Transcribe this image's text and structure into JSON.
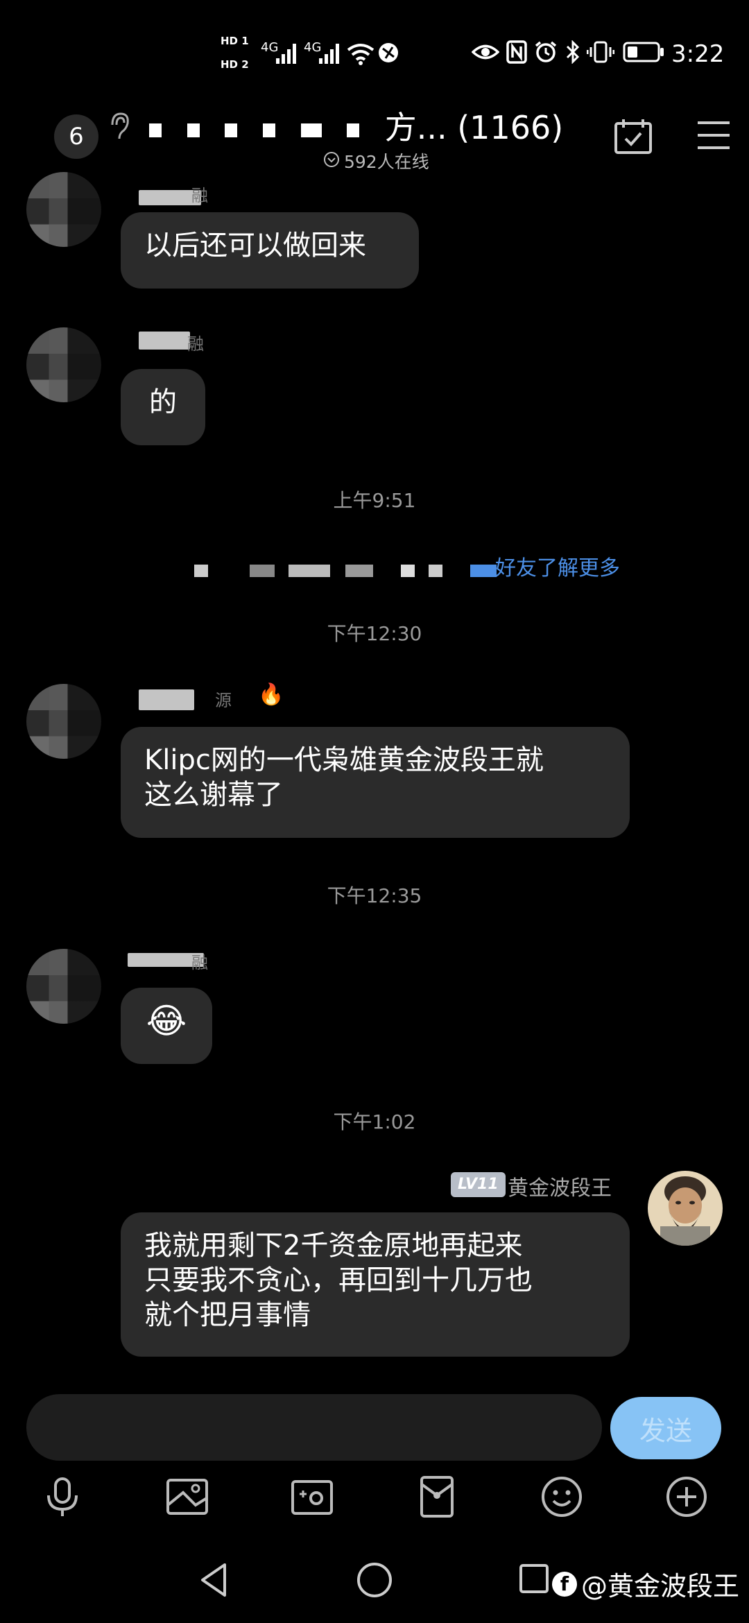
{
  "status_bar": {
    "hd1": "HD 1",
    "hd2": "HD 2",
    "net1": "4G",
    "net2": "4G",
    "time": "3:22"
  },
  "header": {
    "unread_count": "6",
    "group_title_suffix": "方... (1166)",
    "online_text": "592人在线"
  },
  "messages": [
    {
      "text": "以后还可以做回来"
    },
    {
      "text": "的"
    },
    {
      "text": "Klipc网的一代枭雄黄金波段王就\n这么谢幕了"
    },
    {
      "text": "😂"
    },
    {
      "text": "我就用剩下2千资金原地再起来\n只要我不贪心，再回到十几万也\n就个把月事情"
    }
  ],
  "sender_name_tails": [
    "融",
    "融",
    "源",
    "融"
  ],
  "fire_emoji": "🔥",
  "timestamps": [
    "上午9:51",
    "下午12:30",
    "下午12:35",
    "下午1:02"
  ],
  "system_notice_link": "好友了解更多",
  "my_message": {
    "level": "LV11",
    "name": "黄金波段王"
  },
  "input": {
    "send_label": "发送"
  },
  "watermark": {
    "text": "@黄金波段王",
    "fb_glyph": "f"
  },
  "colors": {
    "background": "#000000",
    "bubble": "#2b2b2b",
    "send_button": "#87c3f5",
    "link": "#4c8fe6"
  }
}
